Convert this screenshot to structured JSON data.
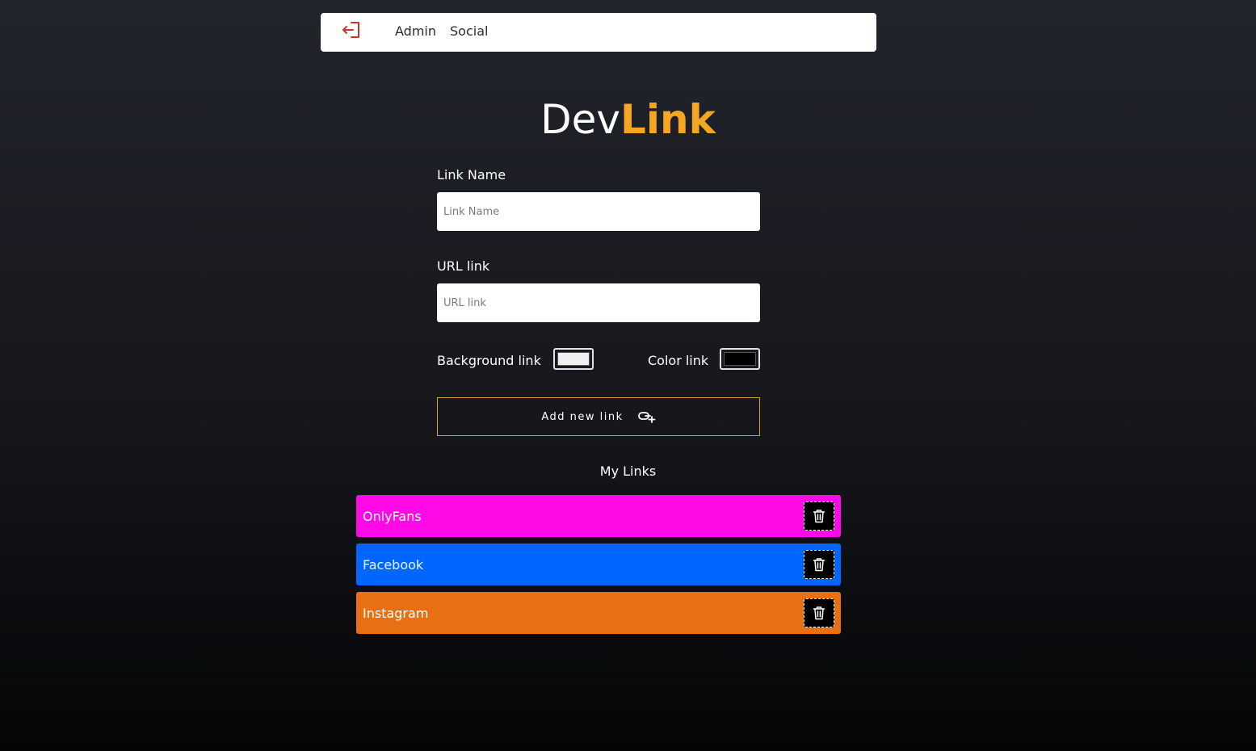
{
  "nav": {
    "logout_icon": "logout-icon",
    "items": [
      {
        "label": "Admin"
      },
      {
        "label": "Social"
      }
    ],
    "logout_color": "#d0312d"
  },
  "brand": {
    "part1": "Dev",
    "part2": "Link",
    "accent": "#f5a623"
  },
  "form": {
    "name_label": "Link Name",
    "name_placeholder": "Link Name",
    "name_value": "",
    "url_label": "URL link",
    "url_placeholder": "URL link",
    "url_value": "",
    "bg_label": "Background link",
    "bg_color": "#f0f0f0",
    "text_label": "Color link",
    "text_color": "#000000",
    "add_label": "Add new link",
    "add_icon": "link-plus-icon"
  },
  "links_section": {
    "title": "My Links",
    "delete_icon": "trash-icon",
    "items": [
      {
        "name": "OnlyFans",
        "bg": "#ff0ae6",
        "color": "#ffffff"
      },
      {
        "name": "Facebook",
        "bg": "#0066ff",
        "color": "#e0faff"
      },
      {
        "name": "Instagram",
        "bg": "#e87014",
        "color": "#ffffff"
      }
    ]
  }
}
